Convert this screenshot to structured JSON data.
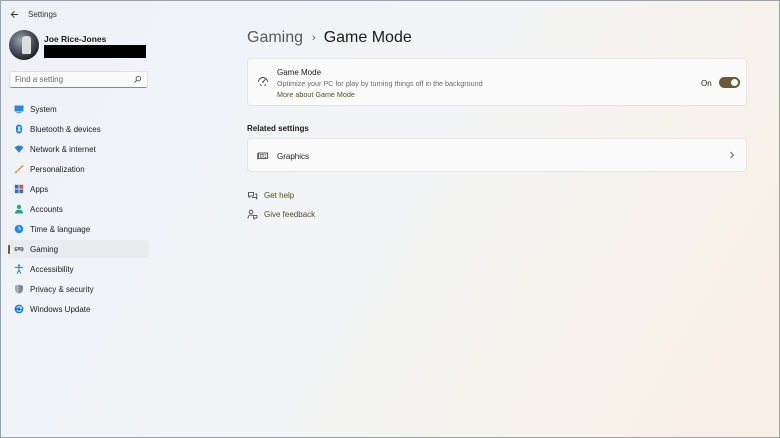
{
  "window": {
    "title": "Settings"
  },
  "profile": {
    "name": "Joe Rice-Jones"
  },
  "search": {
    "placeholder": "Find a setting"
  },
  "sidebar": {
    "items": [
      {
        "label": "System",
        "icon": "system-icon",
        "active": false
      },
      {
        "label": "Bluetooth & devices",
        "icon": "bluetooth-icon",
        "active": false
      },
      {
        "label": "Network & internet",
        "icon": "network-icon",
        "active": false
      },
      {
        "label": "Personalization",
        "icon": "personalization-icon",
        "active": false
      },
      {
        "label": "Apps",
        "icon": "apps-icon",
        "active": false
      },
      {
        "label": "Accounts",
        "icon": "accounts-icon",
        "active": false
      },
      {
        "label": "Time & language",
        "icon": "time-language-icon",
        "active": false
      },
      {
        "label": "Gaming",
        "icon": "gaming-icon",
        "active": true
      },
      {
        "label": "Accessibility",
        "icon": "accessibility-icon",
        "active": false
      },
      {
        "label": "Privacy & security",
        "icon": "privacy-shield-icon",
        "active": false
      },
      {
        "label": "Windows Update",
        "icon": "windows-update-icon",
        "active": false
      }
    ]
  },
  "breadcrumb": {
    "parent": "Gaming",
    "separator": "›",
    "current": "Game Mode"
  },
  "game_mode": {
    "title": "Game Mode",
    "description": "Optimize your PC for play by turning things off in the background",
    "link": "More about Game Mode",
    "toggle_state": "On",
    "enabled": true
  },
  "related": {
    "title": "Related settings",
    "graphics_label": "Graphics"
  },
  "help": {
    "get_help": "Get help",
    "give_feedback": "Give feedback"
  },
  "colors": {
    "accent": "#6b5a3a",
    "link": "#5b4a24"
  }
}
